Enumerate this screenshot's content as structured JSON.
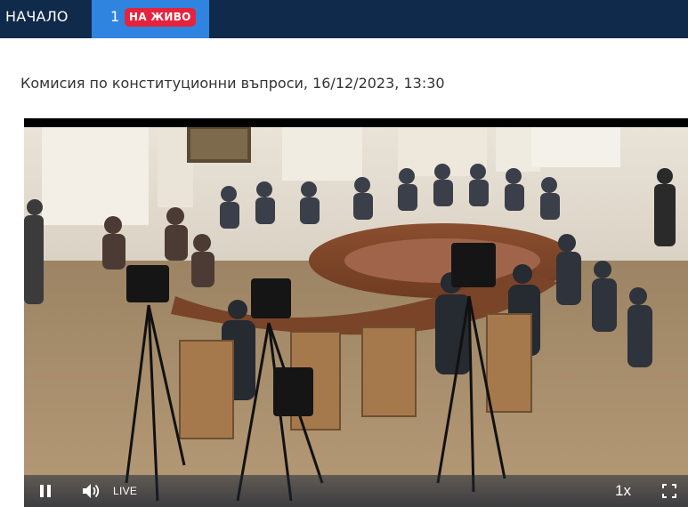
{
  "nav": {
    "home_label": "НАЧАЛО",
    "live_number": "1",
    "live_badge": "НА ЖИВО"
  },
  "session": {
    "title": "Комисия по конституционни въпроси, 16/12/2023, 13:30"
  },
  "player": {
    "live_text": "LIVE",
    "speed": "1x",
    "controls_icons": [
      "pause-icon",
      "volume-icon",
      "fullscreen-icon"
    ]
  },
  "colors": {
    "nav_bg": "#0f2a4a",
    "live_tab": "#2f84e0",
    "live_badge": "#e5233d"
  }
}
